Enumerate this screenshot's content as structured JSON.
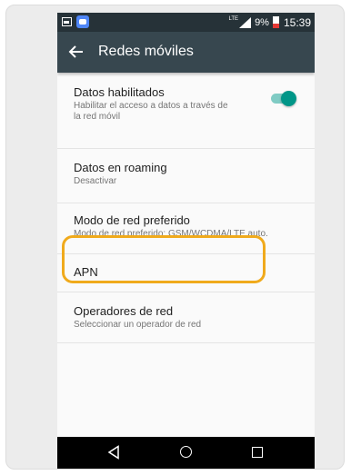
{
  "status_bar": {
    "network_label": "LTE",
    "battery_percent": "9%",
    "time": "15:39",
    "icons": [
      "image-notification-icon",
      "messenger-notification-icon",
      "signal-icon",
      "battery-low-icon"
    ]
  },
  "app_bar": {
    "title": "Redes móviles",
    "back_icon": "arrow-left-icon"
  },
  "settings": {
    "items": [
      {
        "title": "Datos habilitados",
        "subtitle": "Habilitar el acceso a datos a través de la red móvil",
        "toggle_on": true
      },
      {
        "title": "Datos en roaming",
        "subtitle": "Desactivar"
      },
      {
        "title": "Modo de red preferido",
        "subtitle": "Modo de red preferido: GSM/WCDMA/LTE auto."
      },
      {
        "title": "APN",
        "subtitle": ""
      },
      {
        "title": "Operadores de red",
        "subtitle": "Seleccionar un operador de red"
      }
    ]
  },
  "navigation_bar": {
    "icons": [
      "triangle-back-icon",
      "circle-home-icon",
      "square-recents-icon"
    ]
  },
  "colors": {
    "status_bar": "#263238",
    "app_bar": "#37474f",
    "toggle_accent": "#009688",
    "highlight": "#f0aa1c"
  }
}
